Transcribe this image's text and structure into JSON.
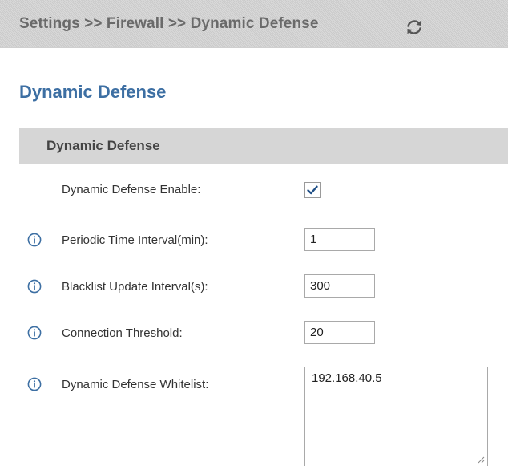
{
  "breadcrumb": {
    "text": "Settings >> Firewall >> Dynamic Defense",
    "refresh_icon": "refresh-icon"
  },
  "page": {
    "title": "Dynamic Defense"
  },
  "section": {
    "title": "Dynamic Defense"
  },
  "fields": {
    "enable": {
      "label": "Dynamic Defense Enable:",
      "checked": true
    },
    "periodic_interval": {
      "label": "Periodic Time Interval(min):",
      "value": "1",
      "icon": "info-icon"
    },
    "blacklist_interval": {
      "label": "Blacklist Update Interval(s):",
      "value": "300",
      "icon": "info-icon"
    },
    "connection_threshold": {
      "label": "Connection Threshold:",
      "value": "20",
      "icon": "info-icon"
    },
    "whitelist": {
      "label": "Dynamic Defense Whitelist:",
      "value": "192.168.40.5",
      "icon": "info-icon"
    }
  },
  "colors": {
    "title": "#3d6fa3",
    "icon": "#3d6fa3",
    "header_bg": "#d6d6d6",
    "checkmark": "#1f4f86"
  }
}
